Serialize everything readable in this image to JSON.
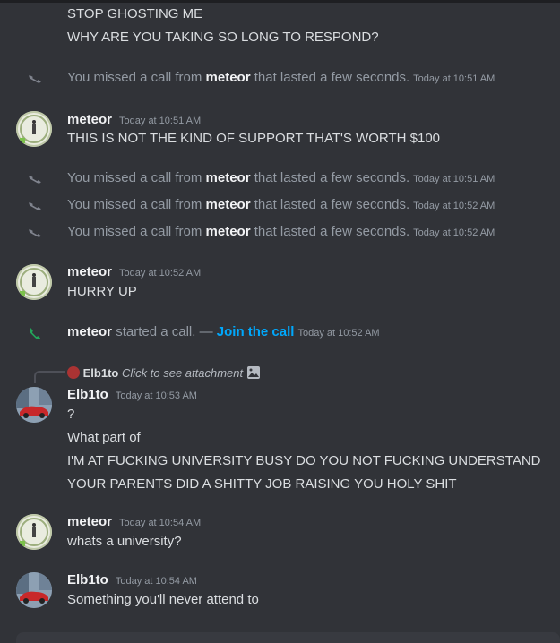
{
  "messages": {
    "m1": "STOP GHOSTING ME",
    "m2": "WHY ARE YOU TAKING SO LONG TO RESPOND?"
  },
  "missed": {
    "prefix": "You missed a call from",
    "user": "meteor",
    "suffix": "that lasted a few seconds.",
    "times": [
      "Today at 10:51 AM",
      "Today at 10:51 AM",
      "Today at 10:52 AM",
      "Today at 10:52 AM"
    ]
  },
  "group1": {
    "author": "meteor",
    "time": "Today at 10:51 AM",
    "text": "THIS IS NOT THE KIND OF SUPPORT THAT'S WORTH $100"
  },
  "group2": {
    "author": "meteor",
    "time": "Today at 10:52 AM",
    "text": "HURRY UP"
  },
  "started": {
    "user": "meteor",
    "text": "started a call. —",
    "link": "Join the call",
    "time": "Today at 10:52 AM"
  },
  "reply": {
    "author": "Elb1to",
    "text": "Click to see attachment"
  },
  "group3": {
    "author": "Elb1to",
    "time": "Today at 10:53 AM",
    "lines": [
      "?",
      "What part of",
      "I'M AT FUCKING UNIVERSITY BUSY DO YOU NOT FUCKING UNDERSTAND",
      "YOUR PARENTS DID A SHITTY JOB RAISING YOU HOLY SHIT"
    ]
  },
  "group4": {
    "author": "meteor",
    "time": "Today at 10:54 AM",
    "text": "whats a university?"
  },
  "group5": {
    "author": "Elb1to",
    "time": "Today at 10:54 AM",
    "text": "Something you'll never attend to"
  },
  "colors": {
    "background": "#313338",
    "link": "#00a8fc",
    "call_green": "#23a55a",
    "muted": "#949ba4"
  },
  "icons": [
    "phone-missed-icon",
    "phone-call-icon",
    "image-icon"
  ]
}
